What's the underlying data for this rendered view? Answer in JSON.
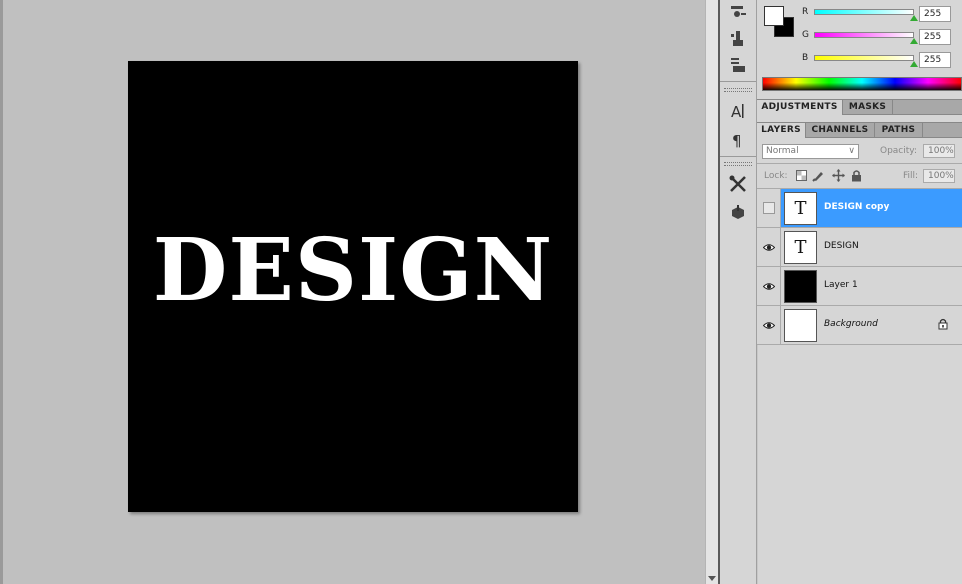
{
  "canvas": {
    "text": "DESIGN"
  },
  "color_panel": {
    "channels": [
      {
        "label": "R",
        "value": "255"
      },
      {
        "label": "G",
        "value": "255"
      },
      {
        "label": "B",
        "value": "255"
      }
    ],
    "foreground": "#ffffff",
    "background": "#000000"
  },
  "adjust_tabs": [
    "ADJUSTMENTS",
    "MASKS"
  ],
  "layer_tabs": [
    "LAYERS",
    "CHANNELS",
    "PATHS"
  ],
  "layers_panel": {
    "blend_mode": "Normal",
    "opacity_label": "Opacity:",
    "opacity": "100%",
    "lock_label": "Lock:",
    "fill_label": "Fill:",
    "fill": "100%",
    "layers": [
      {
        "name": "DESIGN copy",
        "type": "text",
        "selected": true,
        "visible": false
      },
      {
        "name": "DESIGN",
        "type": "text",
        "selected": false,
        "visible": true
      },
      {
        "name": "Layer 1",
        "type": "black",
        "selected": false,
        "visible": true
      },
      {
        "name": "Background",
        "type": "white",
        "selected": false,
        "visible": true,
        "locked": true
      }
    ]
  },
  "tool_icons": [
    "brush-presets-icon",
    "clone-source-icon",
    "tool-presets-icon",
    "character-icon",
    "paragraph-icon",
    "tools-icon",
    "3d-icon"
  ],
  "colors": {
    "selection": "#3b9bff",
    "canvas_bg": "#c0c0c0",
    "panel_bg": "#d6d6d6"
  }
}
